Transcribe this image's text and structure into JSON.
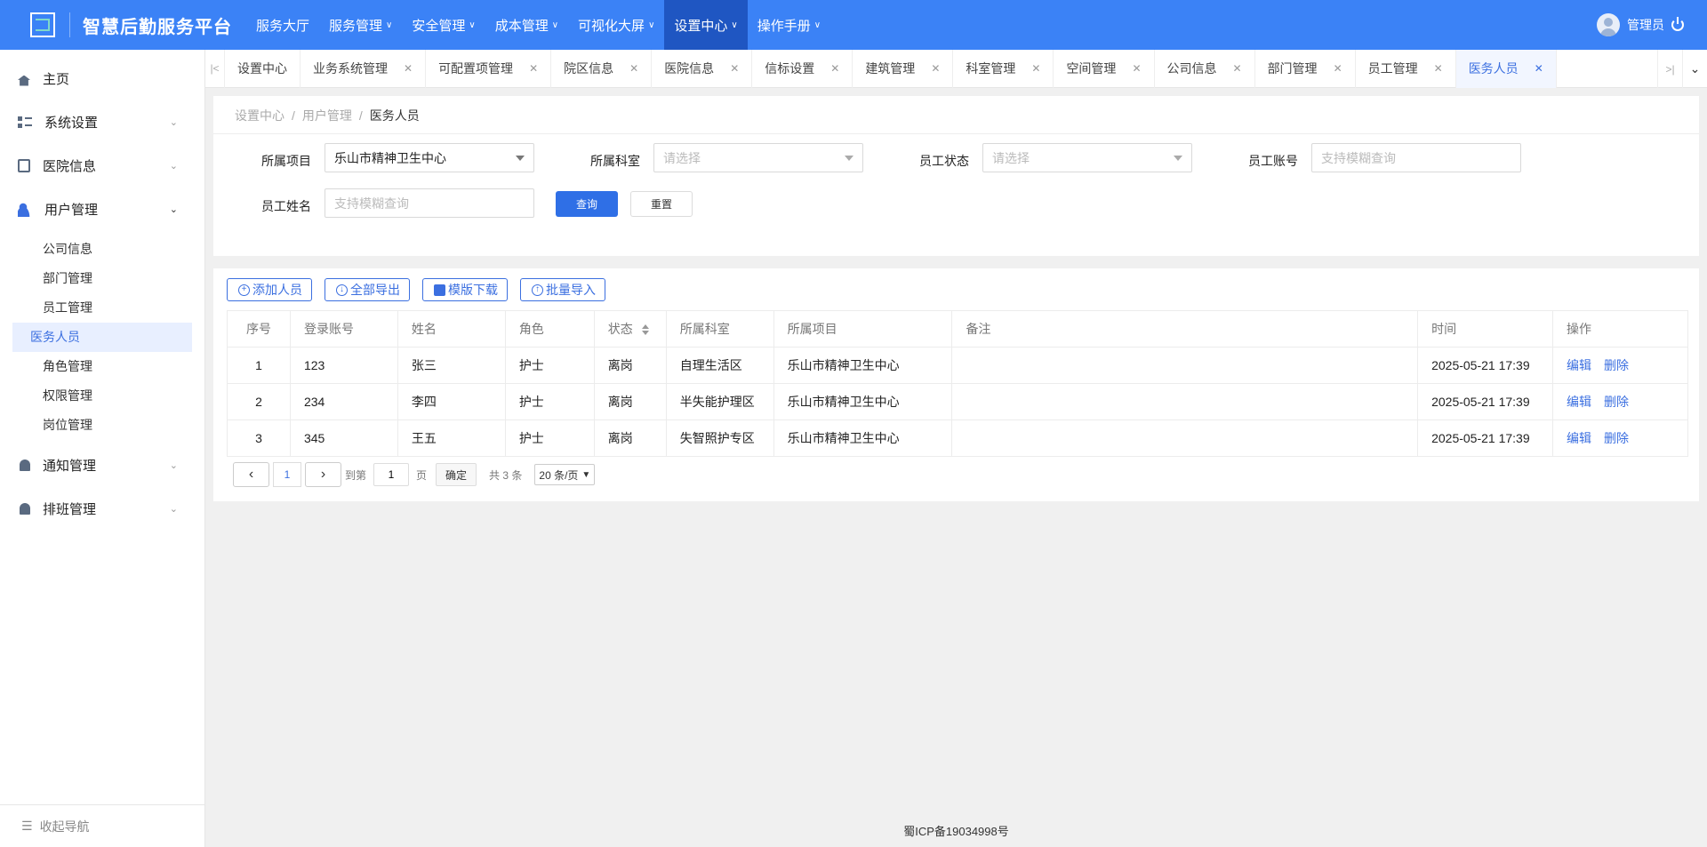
{
  "app": {
    "title": "智慧后勤服务平台"
  },
  "topnav": [
    {
      "label": "服务大厅",
      "caret": false,
      "active": false
    },
    {
      "label": "服务管理",
      "caret": true,
      "active": false
    },
    {
      "label": "安全管理",
      "caret": true,
      "active": false
    },
    {
      "label": "成本管理",
      "caret": true,
      "active": false
    },
    {
      "label": "可视化大屏",
      "caret": true,
      "active": false
    },
    {
      "label": "设置中心",
      "caret": true,
      "active": true
    },
    {
      "label": "操作手册",
      "caret": true,
      "active": false
    }
  ],
  "user": {
    "name": "管理员"
  },
  "sidebar": {
    "items": [
      {
        "label": "主页"
      },
      {
        "label": "系统设置"
      },
      {
        "label": "医院信息"
      },
      {
        "label": "用户管理"
      },
      {
        "label": "通知管理"
      },
      {
        "label": "排班管理"
      }
    ],
    "sub_items": [
      "公司信息",
      "部门管理",
      "员工管理",
      "医务人员",
      "角色管理",
      "权限管理",
      "岗位管理"
    ],
    "active_sub": "医务人员",
    "collapse_label": "收起导航"
  },
  "tabs": [
    {
      "label": "设置中心",
      "closable": false,
      "active": false
    },
    {
      "label": "业务系统管理",
      "closable": true,
      "active": false
    },
    {
      "label": "可配置项管理",
      "closable": true,
      "active": false
    },
    {
      "label": "院区信息",
      "closable": true,
      "active": false
    },
    {
      "label": "医院信息",
      "closable": true,
      "active": false
    },
    {
      "label": "信标设置",
      "closable": true,
      "active": false
    },
    {
      "label": "建筑管理",
      "closable": true,
      "active": false
    },
    {
      "label": "科室管理",
      "closable": true,
      "active": false
    },
    {
      "label": "空间管理",
      "closable": true,
      "active": false
    },
    {
      "label": "公司信息",
      "closable": true,
      "active": false
    },
    {
      "label": "部门管理",
      "closable": true,
      "active": false
    },
    {
      "label": "员工管理",
      "closable": true,
      "active": false
    },
    {
      "label": "医务人员",
      "closable": true,
      "active": true
    }
  ],
  "breadcrumb": [
    "设置中心",
    "用户管理",
    "医务人员"
  ],
  "filters": {
    "project_label": "所属项目",
    "project_value": "乐山市精神卫生中心",
    "dept_label": "所属科室",
    "dept_placeholder": "请选择",
    "status_label": "员工状态",
    "status_placeholder": "请选择",
    "account_label": "员工账号",
    "account_placeholder": "支持模糊查询",
    "name_label": "员工姓名",
    "name_placeholder": "支持模糊查询",
    "search_button": "查询",
    "reset_button": "重置"
  },
  "toolbar": {
    "add": "添加人员",
    "export": "全部导出",
    "template": "模版下载",
    "import": "批量导入"
  },
  "table": {
    "columns": [
      "序号",
      "登录账号",
      "姓名",
      "角色",
      "状态",
      "所属科室",
      "所属项目",
      "备注",
      "时间",
      "操作"
    ],
    "rows": [
      {
        "no": "1",
        "account": "123",
        "name": "张三",
        "role": "护士",
        "status": "离岗",
        "dept": "自理生活区",
        "project": "乐山市精神卫生中心",
        "remark": "",
        "time": "2025-05-21 17:39"
      },
      {
        "no": "2",
        "account": "234",
        "name": "李四",
        "role": "护士",
        "status": "离岗",
        "dept": "半失能护理区",
        "project": "乐山市精神卫生中心",
        "remark": "",
        "time": "2025-05-21 17:39"
      },
      {
        "no": "3",
        "account": "345",
        "name": "王五",
        "role": "护士",
        "status": "离岗",
        "dept": "失智照护专区",
        "project": "乐山市精神卫生中心",
        "remark": "",
        "time": "2025-05-21 17:39"
      }
    ],
    "edit_label": "编辑",
    "delete_label": "删除"
  },
  "pager": {
    "current_page": "1",
    "goto_label": "到第",
    "goto_value": "1",
    "page_unit": "页",
    "confirm": "确定",
    "total": "共 3 条",
    "page_size": "20 条/页"
  },
  "footer": {
    "icp": "蜀ICP备19034998号"
  }
}
